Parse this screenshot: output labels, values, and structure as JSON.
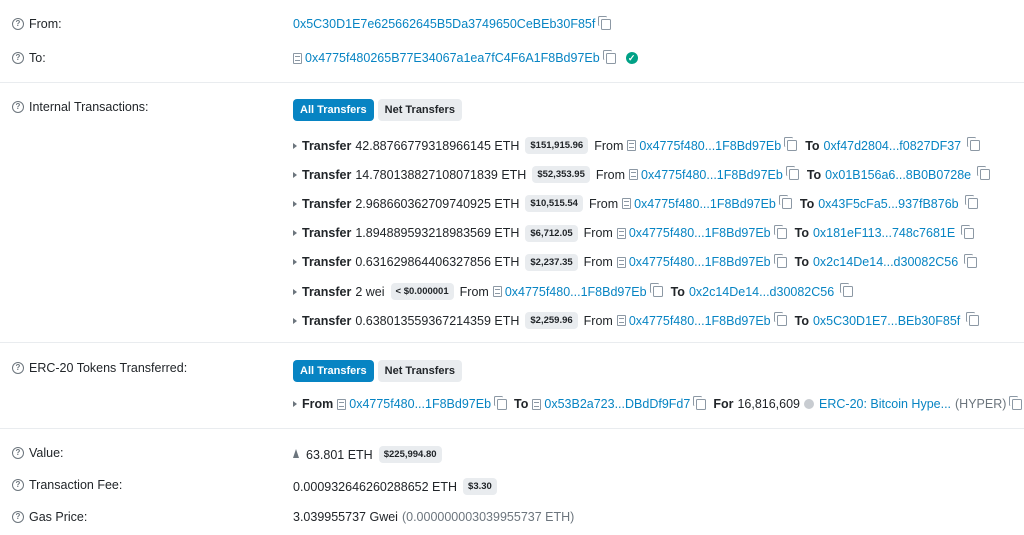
{
  "from": {
    "label": "From:",
    "address": "0x5C30D1E7e625662645B5Da3749650CeBEb30F85f"
  },
  "to": {
    "label": "To:",
    "address": "0x4775f480265B77E34067a1ea7fC4F6A1F8Bd97Eb"
  },
  "internal": {
    "label": "Internal Transactions:",
    "tabs": [
      "All Transfers",
      "Net Transfers"
    ],
    "word_transfer": "Transfer",
    "word_from": "From",
    "word_to": "To",
    "rows": [
      {
        "amount": "42.88766779318966145 ETH",
        "usd": "$151,915.96",
        "from": "0x4775f480...1F8Bd97Eb",
        "to": "0xf47d2804...f0827DF37"
      },
      {
        "amount": "14.780138827108071839 ETH",
        "usd": "$52,353.95",
        "from": "0x4775f480...1F8Bd97Eb",
        "to": "0x01B156a6...8B0B0728e"
      },
      {
        "amount": "2.968660362709740925 ETH",
        "usd": "$10,515.54",
        "from": "0x4775f480...1F8Bd97Eb",
        "to": "0x43F5cFa5...937fB876b"
      },
      {
        "amount": "1.894889593218983569 ETH",
        "usd": "$6,712.05",
        "from": "0x4775f480...1F8Bd97Eb",
        "to": "0x181eF113...748c7681E"
      },
      {
        "amount": "0.631629864406327856 ETH",
        "usd": "$2,237.35",
        "from": "0x4775f480...1F8Bd97Eb",
        "to": "0x2c14De14...d30082C56"
      },
      {
        "amount": "2 wei",
        "usd": "< $0.000001",
        "from": "0x4775f480...1F8Bd97Eb",
        "to": "0x2c14De14...d30082C56"
      },
      {
        "amount": "0.638013559367214359 ETH",
        "usd": "$2,259.96",
        "from": "0x4775f480...1F8Bd97Eb",
        "to": "0x5C30D1E7...BEb30F85f"
      }
    ]
  },
  "erc20": {
    "label": "ERC-20 Tokens Transferred:",
    "tabs": [
      "All Transfers",
      "Net Transfers"
    ],
    "word_from": "From",
    "word_to": "To",
    "word_for": "For",
    "from": "0x4775f480...1F8Bd97Eb",
    "to": "0x53B2a723...DBdDf9Fd7",
    "amount": "16,816,609",
    "token": "ERC-20: Bitcoin Hype...",
    "symbol": "(HYPER)"
  },
  "value": {
    "label": "Value:",
    "amount": "63.801 ETH",
    "usd": "$225,994.80"
  },
  "fee": {
    "label": "Transaction Fee:",
    "amount": "0.000932646260288652 ETH",
    "usd": "$3.30"
  },
  "gas": {
    "label": "Gas Price:",
    "gwei": "3.039955737 Gwei",
    "eth": "(0.000000003039955737 ETH)"
  },
  "icons": {
    "help": "question-circle-icon",
    "copy": "copy-icon",
    "contract": "contract-doc-icon",
    "verified": "check-circle-icon",
    "eth": "ethereum-icon",
    "token": "token-logo-icon"
  },
  "colors": {
    "link": "#0784c3",
    "active_tab": "#0784c3",
    "verified": "#00a186",
    "badge_bg": "#e9ecef"
  }
}
